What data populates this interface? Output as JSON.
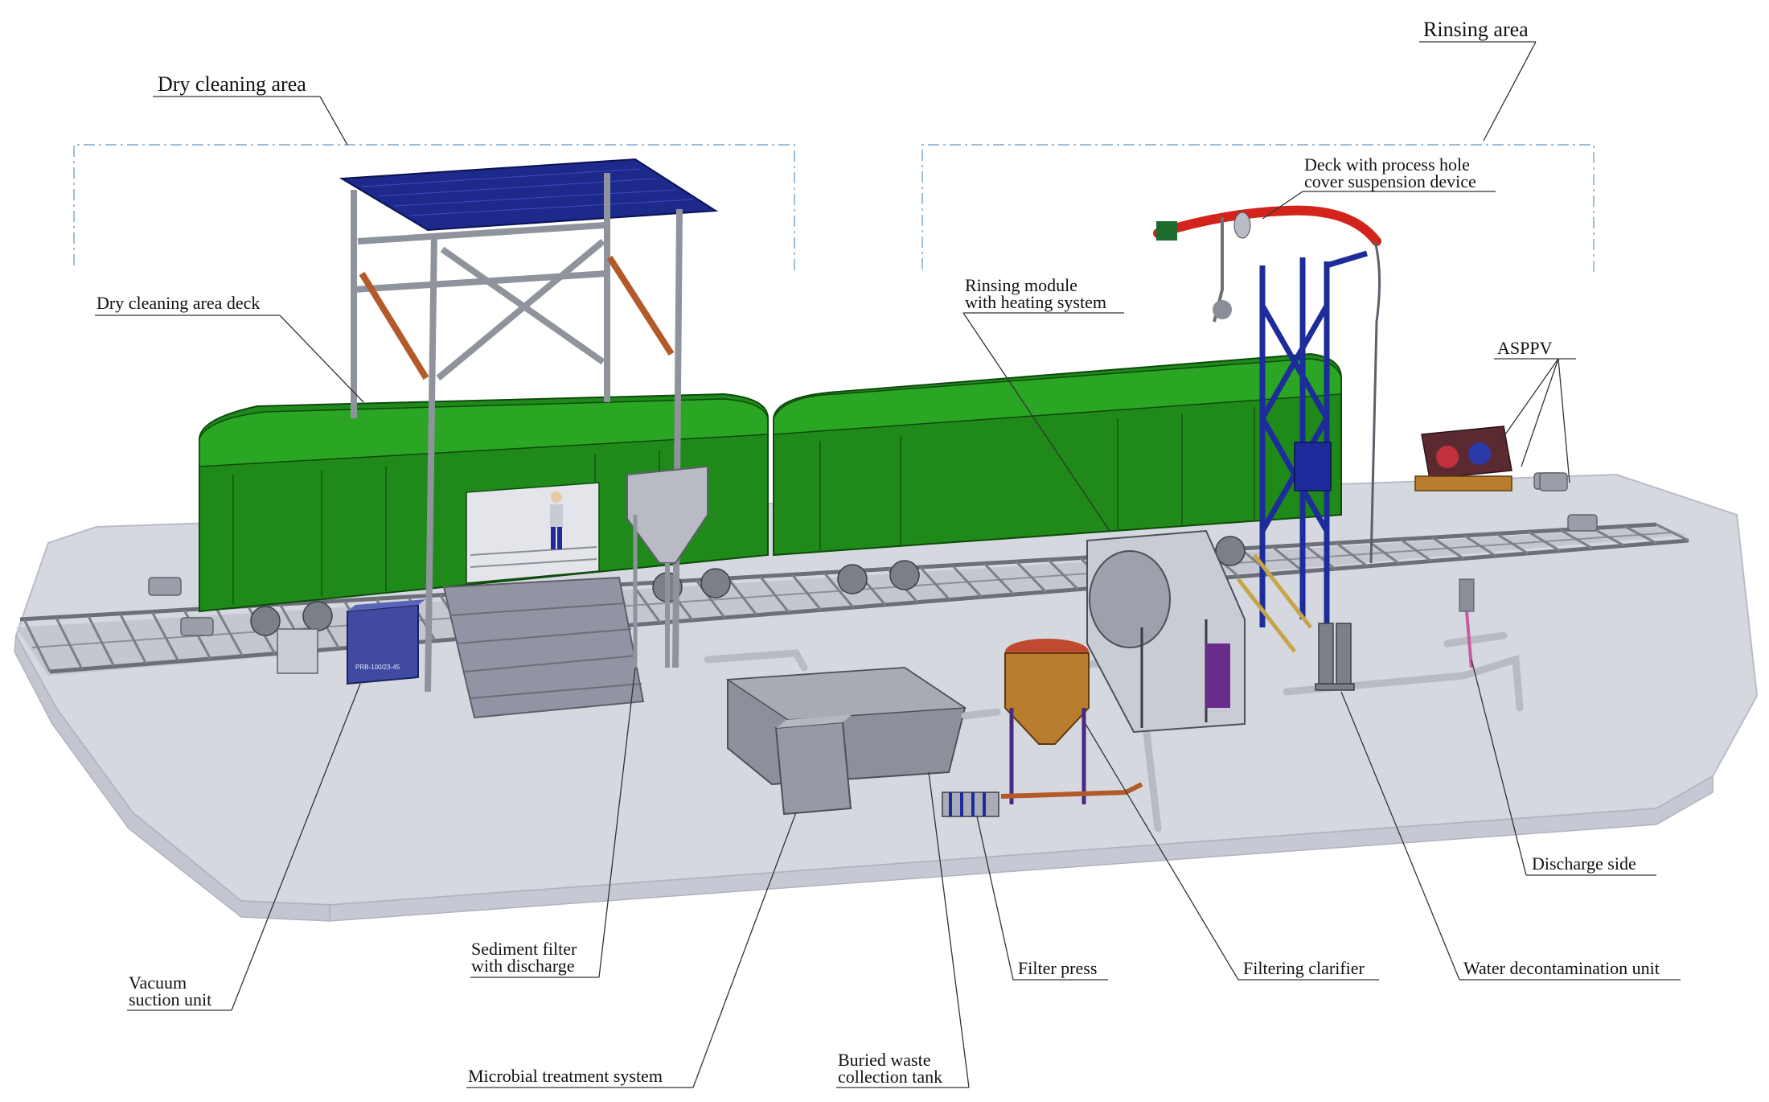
{
  "colors": {
    "platform": "#d6d8e0",
    "platform_edge": "#b9bcc8",
    "wagon": "#1f8a1a",
    "wagon_dark": "#146212",
    "steel": "#8f949c",
    "canopy": "#1d2a8c",
    "bracket": "#b35a2a",
    "blue_frame": "#1d2c9a",
    "red_pipe": "#d2231c",
    "bronze": "#b97d2e",
    "tank": "#8d8f9a",
    "bracket_line": "#9cc0dc"
  },
  "areas": [
    {
      "id": "dry",
      "label": "Dry cleaning area"
    },
    {
      "id": "rinse",
      "label": "Rinsing area"
    }
  ],
  "callouts": [
    {
      "id": "dry_deck",
      "lines": [
        "Dry cleaning area deck"
      ]
    },
    {
      "id": "deck_hole",
      "lines": [
        "Deck with process hole",
        "cover suspension device"
      ]
    },
    {
      "id": "rinse_module",
      "lines": [
        "Rinsing module",
        "with heating system"
      ]
    },
    {
      "id": "asppv",
      "lines": [
        "ASPPV"
      ]
    },
    {
      "id": "discharge",
      "lines": [
        "Discharge side"
      ]
    },
    {
      "id": "vacuum",
      "lines": [
        "Vacuum",
        "suction unit"
      ]
    },
    {
      "id": "sediment",
      "lines": [
        "Sediment filter",
        "with discharge"
      ]
    },
    {
      "id": "microbial",
      "lines": [
        "Microbial treatment system"
      ]
    },
    {
      "id": "buried",
      "lines": [
        "Buried waste",
        "collection tank"
      ]
    },
    {
      "id": "filter_press",
      "lines": [
        "Filter press"
      ]
    },
    {
      "id": "clarifier",
      "lines": [
        "Filtering clarifier"
      ]
    },
    {
      "id": "decon",
      "lines": [
        "Water decontamination unit"
      ]
    }
  ],
  "equipment": {
    "vacuum_unit_plate": "PRB-100/23-45"
  }
}
